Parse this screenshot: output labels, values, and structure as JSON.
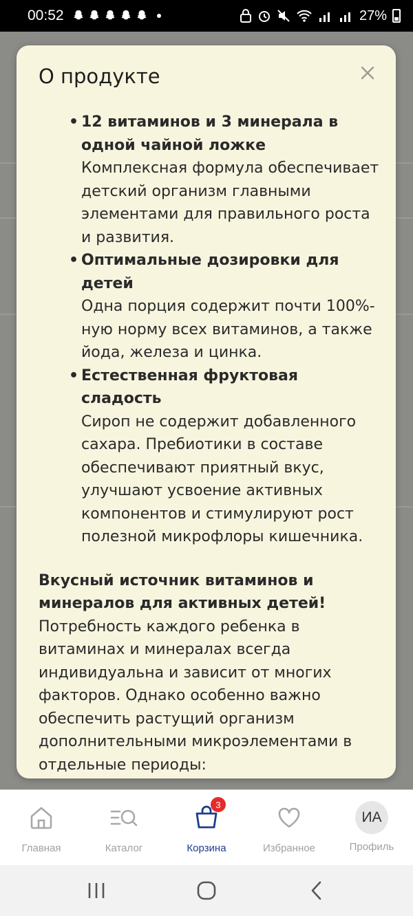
{
  "status_bar": {
    "time": "00:52",
    "battery": "27%"
  },
  "modal": {
    "title": "О продукте",
    "bullets": [
      {
        "title": "12 витаминов и 3 минерала в одной чайной ложке",
        "text": "Комплексная формула обеспечивает детский организм главными элементами для правильного роста и развития."
      },
      {
        "title": "Оптимальные дозировки для детей",
        "text": "Одна порция содержит почти 100%-ную норму всех витаминов, а также йода, железа и цинка."
      },
      {
        "title": "Естественная фруктовая сладость",
        "text": "Сироп не содержит добавленного сахара. Пребиотики в составе обеспечивают приятный вкус, улучшают усвоение активных компонентов и стимулируют рост полезной микрофлоры кишечника."
      }
    ],
    "paragraph": {
      "title": "Вкусный источник витаминов и минералов для активных детей!",
      "text": "Потребность каждого ребенка в витаминах и минералах всегда индивидуальна и зависит от многих факторов. Однако особенно важно обеспечить растущий организм дополнительными микроэлементами в отдельные периоды:"
    }
  },
  "bottom_nav": {
    "items": [
      {
        "label": "Главная",
        "icon": "home-icon"
      },
      {
        "label": "Каталог",
        "icon": "catalog-search-icon"
      },
      {
        "label": "Корзина",
        "icon": "cart-icon",
        "badge": "3",
        "active": true
      },
      {
        "label": "Избранное",
        "icon": "heart-icon"
      },
      {
        "label": "Профиль",
        "icon": "avatar",
        "initials": "ИА"
      }
    ]
  },
  "colors": {
    "modal_bg": "#f8f5df",
    "accent": "#1d3c8c",
    "badge": "#e32b2b"
  }
}
